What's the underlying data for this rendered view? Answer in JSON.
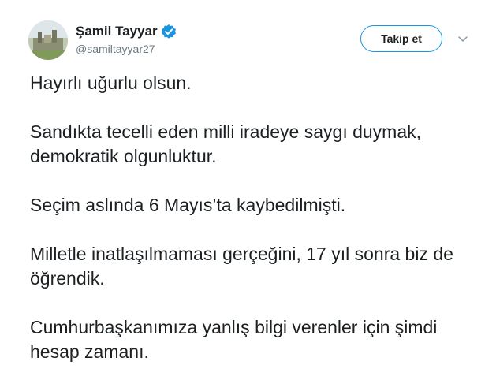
{
  "user": {
    "display_name": "Şamil Tayyar",
    "handle": "@samiltayyar27",
    "verified": true,
    "avatar_icon": "profile-photo"
  },
  "header": {
    "follow_label": "Takip et",
    "menu_icon": "chevron-down-icon"
  },
  "tweet": {
    "paragraphs": [
      "Hayırlı uğurlu olsun.",
      "Sandıkta tecelli eden milli iradeye saygı duymak, demokratik olgunluktur.",
      "Seçim aslında 6 Mayıs’ta kaybedilmişti.",
      "Milletle inatlaşılmaması gerçeğini, 17 yıl sonra biz de öğrendik.",
      "Cumhurbaşkanımıza yanlış bilgi verenler için şimdi hesap zamanı."
    ]
  },
  "colors": {
    "text": "#1c2022",
    "secondary_text": "#697882",
    "accent": "#1b95e0"
  }
}
